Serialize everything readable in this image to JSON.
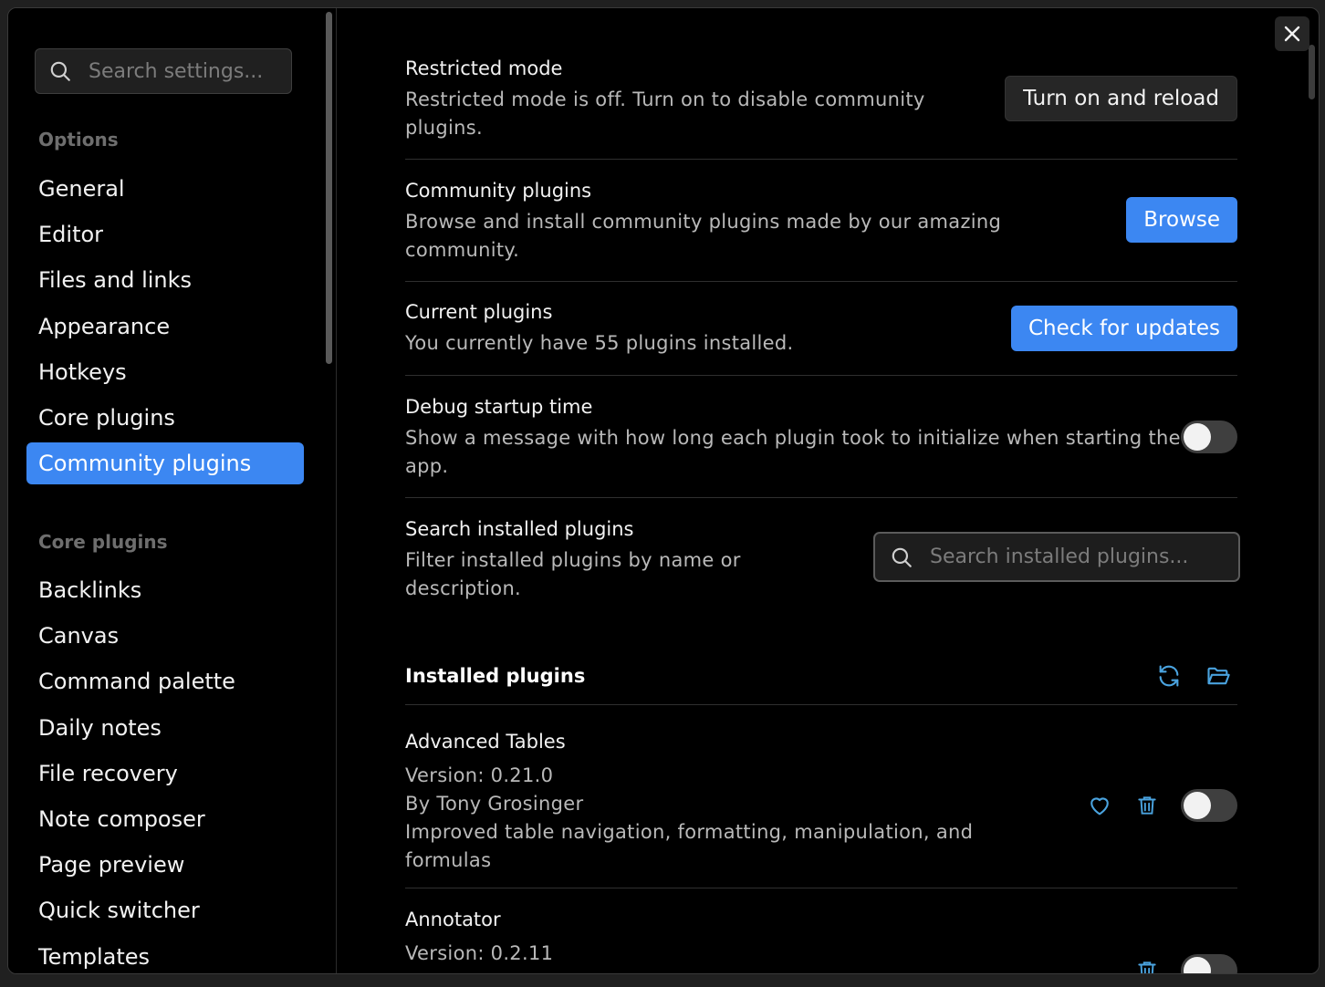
{
  "sidebar": {
    "search_placeholder": "Search settings...",
    "options_heading": "Options",
    "options_items": [
      "General",
      "Editor",
      "Files and links",
      "Appearance",
      "Hotkeys",
      "Core plugins",
      "Community plugins"
    ],
    "active_item": "Community plugins",
    "core_heading": "Core plugins",
    "core_items": [
      "Backlinks",
      "Canvas",
      "Command palette",
      "Daily notes",
      "File recovery",
      "Note composer",
      "Page preview",
      "Quick switcher",
      "Templates"
    ]
  },
  "settings": {
    "restricted": {
      "name": "Restricted mode",
      "desc": "Restricted mode is off. Turn on to disable community plugins.",
      "button": "Turn on and reload"
    },
    "community": {
      "name": "Community plugins",
      "desc": "Browse and install community plugins made by our amazing community.",
      "button": "Browse"
    },
    "current": {
      "name": "Current plugins",
      "desc": "You currently have 55 plugins installed.",
      "button": "Check for updates"
    },
    "debug": {
      "name": "Debug startup time",
      "desc": "Show a message with how long each plugin took to initialize when starting the app.",
      "enabled": false
    },
    "search": {
      "name": "Search installed plugins",
      "desc": "Filter installed plugins by name or description.",
      "placeholder": "Search installed plugins..."
    }
  },
  "installed": {
    "title": "Installed plugins",
    "plugins": [
      {
        "name": "Advanced Tables",
        "version": "Version: 0.21.0",
        "author": "By Tony Grosinger",
        "desc": "Improved table navigation, formatting, manipulation, and formulas",
        "enabled": false
      },
      {
        "name": "Annotator",
        "version": "Version: 0.2.11",
        "enabled": false
      }
    ]
  },
  "colors": {
    "accent": "#3c87f2",
    "icon_accent": "#4aa3df"
  }
}
